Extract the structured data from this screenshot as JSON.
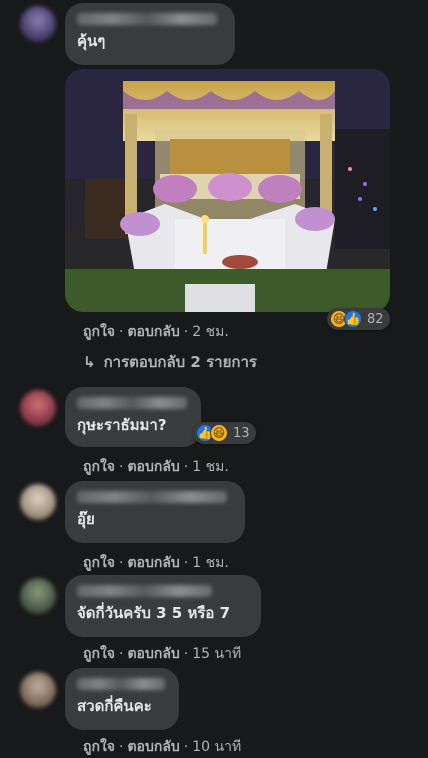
{
  "comments": [
    {
      "text": "คุ้นๆ",
      "time": "2 ชม.",
      "reaction_count": "82",
      "reactions": [
        "haha-icon",
        "like-icon"
      ]
    },
    {
      "text": "กุษะราธัมมา?",
      "time": "1 ชม.",
      "reaction_count": "13",
      "reactions": [
        "like-icon",
        "haha-icon"
      ]
    },
    {
      "text": "อุ๊ย",
      "time": "1 ชม."
    },
    {
      "text": "จัดกี่วันครับ 3 5 หรือ 7",
      "time": "15 นาที"
    },
    {
      "text": "สวดกี่คืนคะ",
      "time": "10 นาที"
    }
  ],
  "labels": {
    "like": "ถูกใจ",
    "reply": "ตอบกลับ",
    "separator": "·",
    "view_replies": "การตอบกลับ 2 รายการ",
    "reply_arrow": "↳"
  },
  "colors": {
    "background": "#18191a",
    "bubble": "#3a3b3c",
    "text": "#e4e6eb",
    "secondary_text": "#b0b3b8",
    "like_blue": "#1877f2",
    "haha_yellow": "#f7b125"
  }
}
